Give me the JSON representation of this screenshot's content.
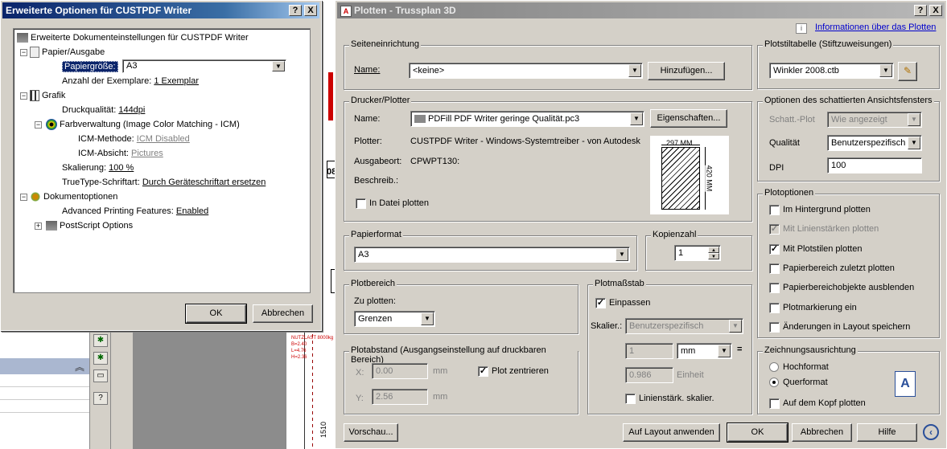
{
  "opt_dialog": {
    "title": "Erweiterte Optionen für CUSTPDF Writer",
    "help_btn": "?",
    "close_btn": "X",
    "tree": {
      "root": "Erweiterte Dokumenteinstellungen für CUSTPDF Writer",
      "paper_output": "Papier/Ausgabe",
      "paper_size_label": "Papiergröße:",
      "paper_size_value": "A3",
      "copies_label": "Anzahl der Exemplare:",
      "copies_value": "1 Exemplar",
      "graphic": "Grafik",
      "print_quality_label": "Druckqualität:",
      "print_quality_value": "144dpi",
      "color_mgmt": "Farbverwaltung (Image Color Matching - ICM)",
      "icm_method_label": "ICM-Methode:",
      "icm_method_value": "ICM Disabled",
      "icm_intent_label": "ICM-Absicht:",
      "icm_intent_value": "Pictures",
      "scaling_label": "Skalierung:",
      "scaling_value": "100 %",
      "truetype_label": "TrueType-Schriftart:",
      "truetype_value": "Durch Geräteschriftart ersetzen",
      "doc_options": "Dokumentoptionen",
      "adv_print_label": "Advanced Printing Features:",
      "adv_print_value": "Enabled",
      "postscript": "PostScript Options"
    },
    "ok": "OK",
    "cancel": "Abbrechen"
  },
  "plot_dialog": {
    "title": "Plotten - Trussplan 3D",
    "help_btn": "?",
    "close_btn": "X",
    "info_link": "Informationen über das Plotten",
    "page_setup": {
      "group": "Seiteneinrichtung",
      "name_label": "Name:",
      "name_value": "<keine>",
      "add_btn": "Hinzufügen..."
    },
    "printer": {
      "group": "Drucker/Plotter",
      "name_label": "Name:",
      "name_value": "PDFill PDF Writer geringe Qualität.pc3",
      "props_btn": "Eigenschaften...",
      "plotter_label": "Plotter:",
      "plotter_value": "CUSTPDF Writer - Windows-Systemtreiber - von Autodesk",
      "location_label": "Ausgabeort:",
      "location_value": "CPWPT130:",
      "desc_label": "Beschreib.:",
      "to_file": "In Datei plotten",
      "preview_width": "297 MM",
      "preview_height": "420 MM"
    },
    "paper_format": {
      "group": "Papierformat",
      "value": "A3"
    },
    "copies": {
      "group": "Kopienzahl",
      "value": "1"
    },
    "plot_area": {
      "group": "Plotbereich",
      "label": "Zu plotten:",
      "value": "Grenzen"
    },
    "plot_offset": {
      "group": "Plotabstand (Ausgangseinstellung auf druckbaren Bereich)",
      "x_label": "X:",
      "x_value": "0.00",
      "x_unit": "mm",
      "y_label": "Y:",
      "y_value": "2.56",
      "y_unit": "mm",
      "center": "Plot zentrieren"
    },
    "plot_scale": {
      "group": "Plotmaßstab",
      "fit": "Einpassen",
      "scale_label": "Skalier.:",
      "scale_value": "Benutzerspezifisch",
      "val1": "1",
      "unit": "mm",
      "eq": "=",
      "val2": "0.986",
      "unit2": "Einheit",
      "lineweights": "Linienstärk. skalier."
    },
    "style_table": {
      "group": "Plotstiltabelle (Stiftzuweisungen)",
      "value": "Winkler 2008.ctb"
    },
    "shaded": {
      "group": "Optionen des schattierten Ansichtsfensters",
      "shade_label": "Schatt.-Plot",
      "shade_value": "Wie angezeigt",
      "quality_label": "Qualität",
      "quality_value": "Benutzerspezifisch",
      "dpi_label": "DPI",
      "dpi_value": "100"
    },
    "plot_options": {
      "group": "Plotoptionen",
      "items": [
        {
          "label": "Im Hintergrund plotten",
          "checked": false,
          "disabled": false
        },
        {
          "label": "Mit Linienstärken plotten",
          "checked": true,
          "disabled": true
        },
        {
          "label": "Mit Plotstilen plotten",
          "checked": true,
          "disabled": false
        },
        {
          "label": "Papierbereich zuletzt plotten",
          "checked": false,
          "disabled": false
        },
        {
          "label": "Papierbereichobjekte ausblenden",
          "checked": false,
          "disabled": false
        },
        {
          "label": "Plotmarkierung ein",
          "checked": false,
          "disabled": false
        },
        {
          "label": "Änderungen in Layout speichern",
          "checked": false,
          "disabled": false
        }
      ]
    },
    "orientation": {
      "group": "Zeichnungsausrichtung",
      "portrait": "Hochformat",
      "landscape": "Querformat",
      "upside_down": "Auf dem Kopf plotten",
      "icon_letter": "A"
    },
    "buttons": {
      "preview": "Vorschau...",
      "apply": "Auf Layout anwenden",
      "ok": "OK",
      "cancel": "Abbrechen",
      "help": "Hilfe"
    }
  },
  "background": {
    "drawing_text": [
      "NUTZLAST 8000kg",
      "B=2.40",
      "L=4.76",
      "H=2.36"
    ],
    "side_label": "1510",
    "label_08": "08"
  }
}
